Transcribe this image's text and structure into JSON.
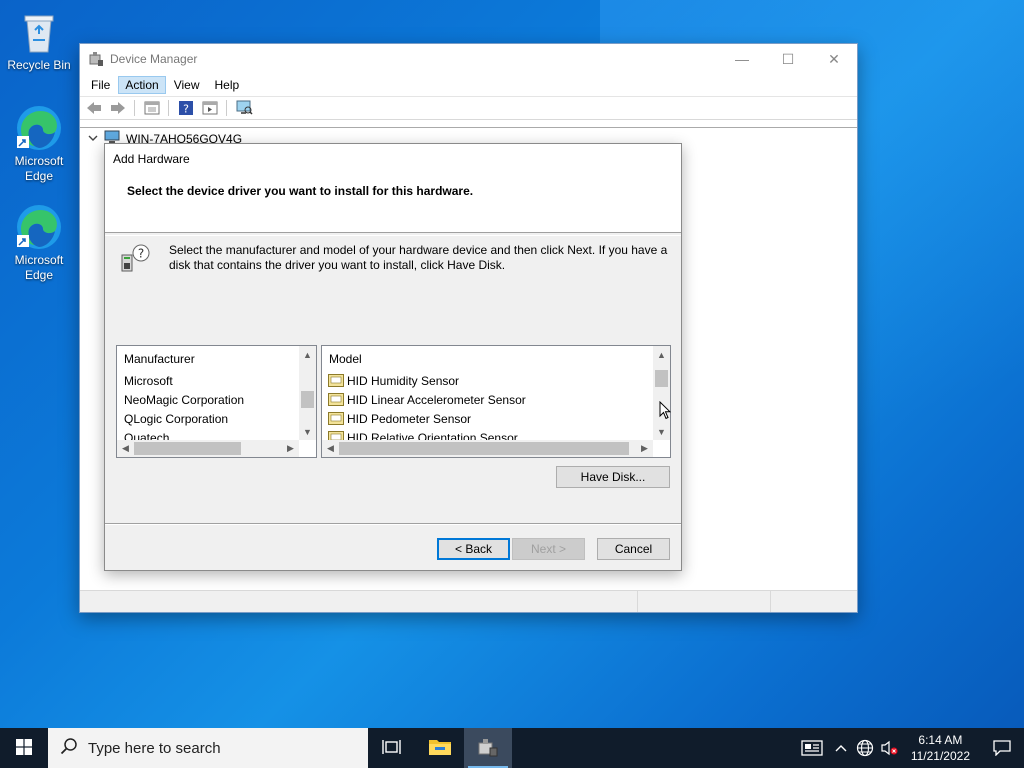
{
  "desktop": {
    "icons": [
      {
        "label": "Recycle Bin",
        "icon": "recycle-bin-icon"
      },
      {
        "label": "Microsoft Edge",
        "icon": "edge-icon"
      },
      {
        "label": "Microsoft Edge",
        "icon": "edge-icon"
      }
    ]
  },
  "device_manager": {
    "title": "Device Manager",
    "menu": [
      "File",
      "Action",
      "View",
      "Help"
    ],
    "active_menu": "Action",
    "tree_root": "WIN-7AHO56GQV4G",
    "window_buttons": {
      "minimize": "—",
      "maximize": "☐",
      "close": "✕"
    }
  },
  "dialog": {
    "title": "Add Hardware",
    "heading": "Select the device driver you want to install for this hardware.",
    "instructions": "Select the manufacturer and model of your hardware device and then click Next. If you have a disk that contains the driver you want to install, click Have Disk.",
    "manufacturer": {
      "header": "Manufacturer",
      "items": [
        "Microsoft",
        "NeoMagic Corporation",
        "QLogic Corporation",
        "Quatech"
      ],
      "selected": "Microsoft"
    },
    "model": {
      "header": "Model",
      "items": [
        "HID Humidity Sensor",
        "HID Linear Accelerometer Sensor",
        "HID Pedometer Sensor",
        "HID Relative Orientation Sensor"
      ]
    },
    "buttons": {
      "have_disk": "Have Disk...",
      "back": "< Back",
      "next": "Next >",
      "cancel": "Cancel"
    }
  },
  "taskbar": {
    "search_placeholder": "Type here to search",
    "time": "6:14 AM",
    "date": "11/21/2022"
  },
  "colors": {
    "accent": "#0078d7",
    "taskbar": "#101c2b"
  }
}
